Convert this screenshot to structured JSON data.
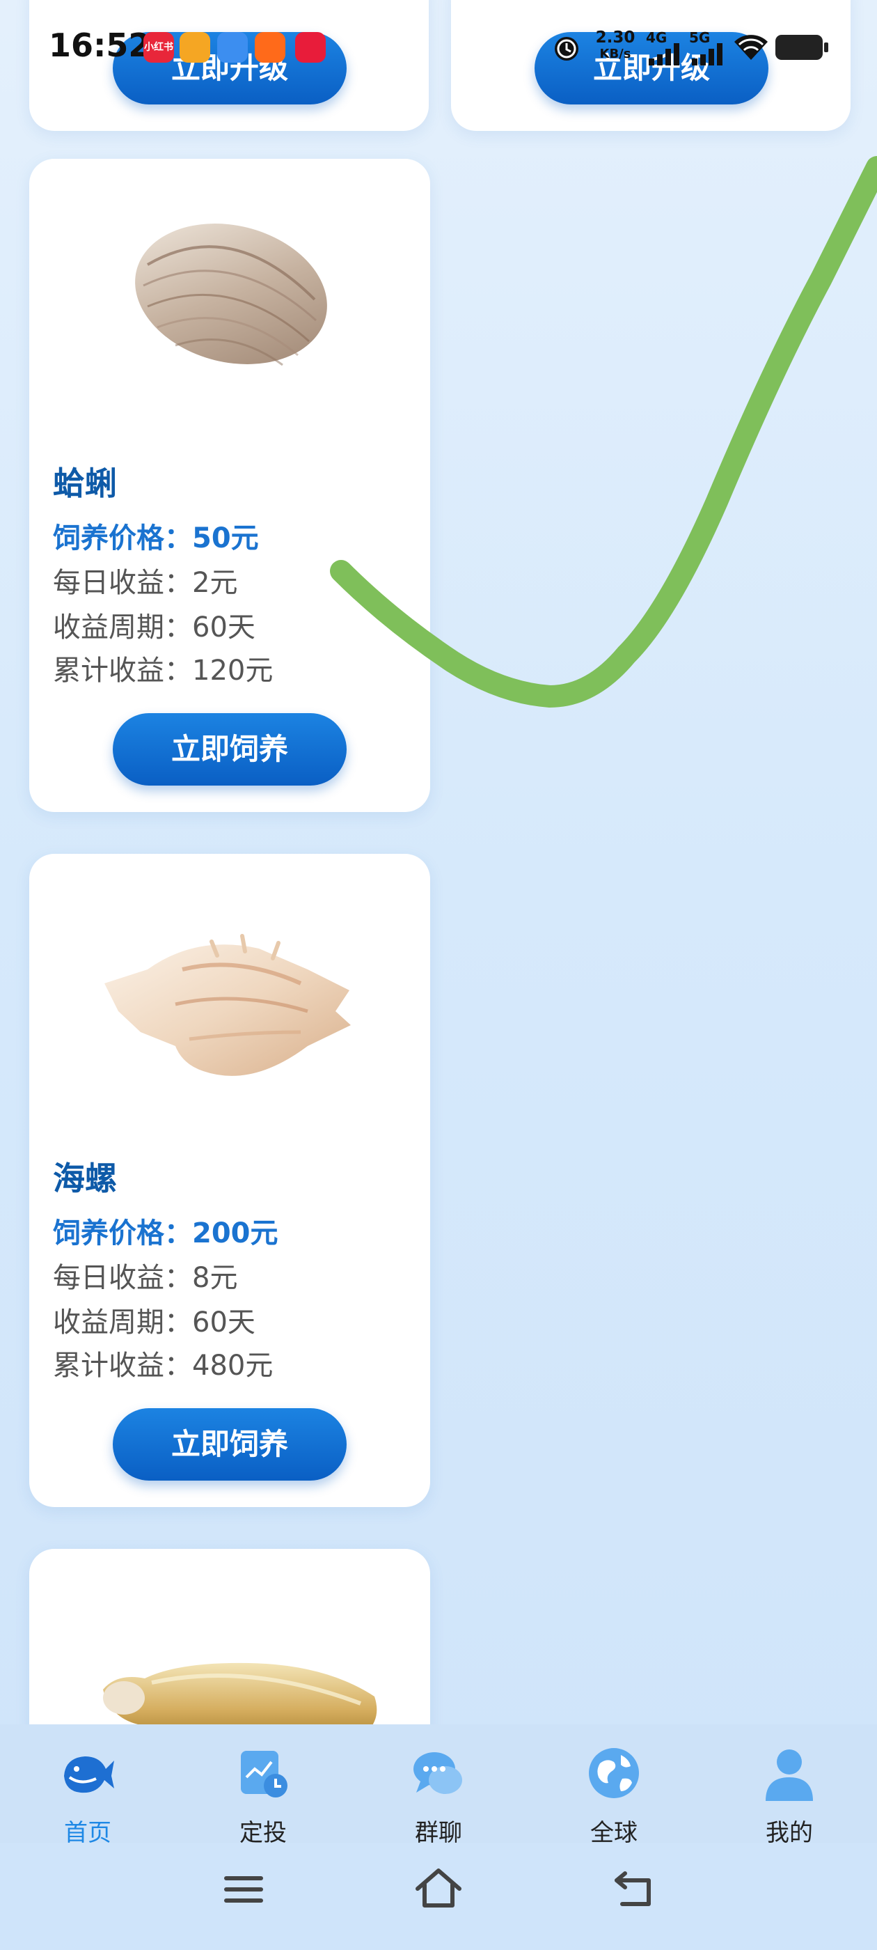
{
  "status_bar": {
    "time": "16:52",
    "app_icons": [
      "小红书",
      "",
      "",
      "",
      ""
    ],
    "network_speed_value": "2.30",
    "network_speed_unit": "KB/s",
    "net_4g": "4G",
    "net_5g": "5G"
  },
  "top_partial_cards": [
    {
      "button": "立即升级"
    },
    {
      "button": "立即升级"
    }
  ],
  "products": [
    {
      "name": "蛤蜊",
      "price": "饲养价格：50元",
      "daily": "每日收益：2元",
      "cycle": "收益周期：60天",
      "total": "累计收益：120元",
      "button": "立即饲养"
    },
    {
      "name": "海螺",
      "price": "饲养价格：200元",
      "daily": "每日收益：8元",
      "cycle": "收益周期：60天",
      "total": "累计收益：480元",
      "button": "立即饲养"
    }
  ],
  "tabs": [
    {
      "label": "首页",
      "icon": "whale-icon",
      "active": true
    },
    {
      "label": "定投",
      "icon": "chart-clock-icon",
      "active": false
    },
    {
      "label": "群聊",
      "icon": "chat-bubbles-icon",
      "active": false
    },
    {
      "label": "全球",
      "icon": "globe-icon",
      "active": false
    },
    {
      "label": "我的",
      "icon": "person-icon",
      "active": false
    }
  ],
  "nav": {
    "menu": "menu-icon",
    "home": "home-icon",
    "back": "back-icon"
  },
  "colors": {
    "accent": "#1a73d0",
    "button": "#0a5fc4",
    "overlay_stroke": "#7fbf5a"
  }
}
